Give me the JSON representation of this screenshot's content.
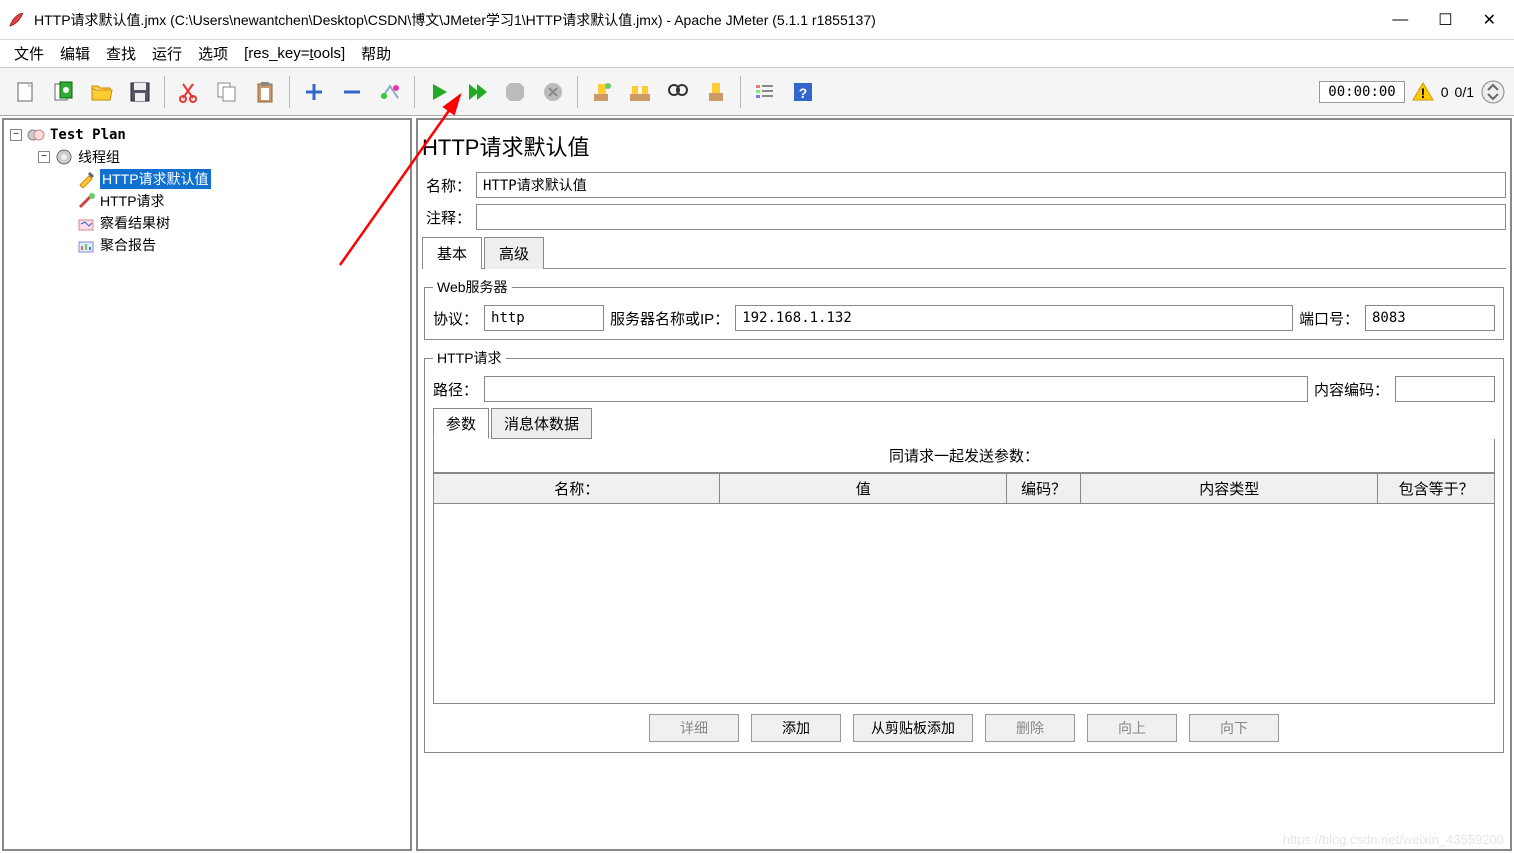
{
  "window": {
    "title": "HTTP请求默认值.jmx (C:\\Users\\newantchen\\Desktop\\CSDN\\博文\\JMeter学习1\\HTTP请求默认值.jmx) - Apache JMeter (5.1.1 r1855137)",
    "minimize": "—",
    "maximize": "☐",
    "close": "✕"
  },
  "menu": {
    "file": "文件",
    "edit": "编辑",
    "search": "查找",
    "run": "运行",
    "options": "选项",
    "tools": "[res_key=tools]",
    "help": "帮助"
  },
  "toolbar": {
    "timer": "00:00:00",
    "warn_count": "0",
    "thread_ratio": "0/1"
  },
  "tree": {
    "root": "Test Plan",
    "thread_group": "线程组",
    "http_defaults": "HTTP请求默认值",
    "http_request": "HTTP请求",
    "view_results": "察看结果树",
    "aggregate": "聚合报告"
  },
  "panel": {
    "title": "HTTP请求默认值",
    "name_label": "名称：",
    "name_value": "HTTP请求默认值",
    "comment_label": "注释：",
    "comment_value": "",
    "tabs": {
      "basic": "基本",
      "advanced": "高级"
    },
    "web_server": {
      "legend": "Web服务器",
      "protocol_label": "协议：",
      "protocol_value": "http",
      "server_label": "服务器名称或IP：",
      "server_value": "192.168.1.132",
      "port_label": "端口号：",
      "port_value": "8083"
    },
    "http_req": {
      "legend": "HTTP请求",
      "path_label": "路径：",
      "path_value": "",
      "encoding_label": "内容编码：",
      "encoding_value": "",
      "subtabs": {
        "params": "参数",
        "body": "消息体数据"
      },
      "params_caption": "同请求一起发送参数：",
      "cols": {
        "name": "名称：",
        "value": "值",
        "encode": "编码？",
        "content_type": "内容类型",
        "include_equals": "包含等于？"
      },
      "buttons": {
        "detail": "详细",
        "add": "添加",
        "add_clipboard": "从剪贴板添加",
        "delete": "删除",
        "up": "向上",
        "down": "向下"
      }
    }
  },
  "watermark": "https://blog.csdn.net/weixin_43559200"
}
